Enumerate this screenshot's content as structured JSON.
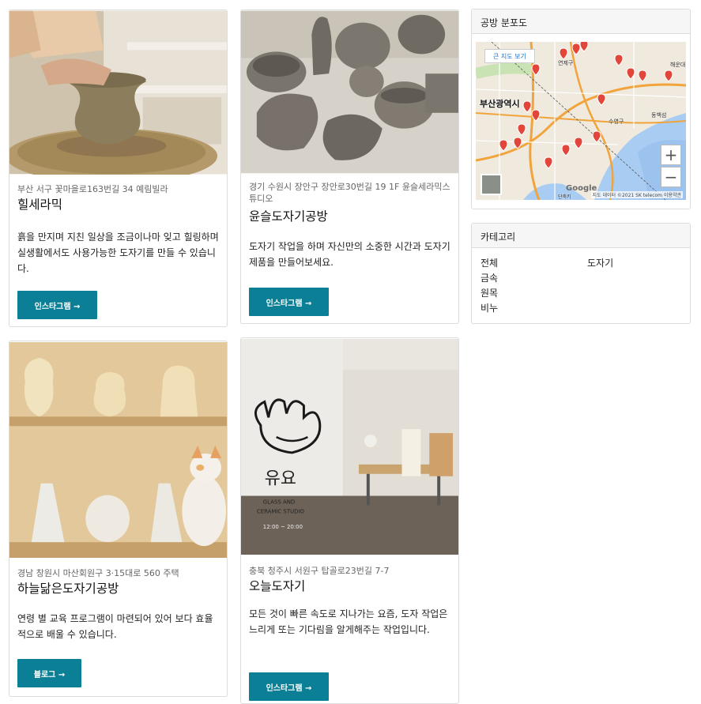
{
  "cards": [
    {
      "address": "부산 서구 꽃마을로163번길 34 예림빌라",
      "title": "힐세라믹",
      "description": "흙을 만지며 지친 일상을 조금이나마 잊고 힐링하며 실생활에서도 사용가능한 도자기를 만들 수 있습니다.",
      "button": "인스타그램 →"
    },
    {
      "address": "경기 수원시 장안구 장안로30번길 19 1F 윤슬세라믹스튜디오",
      "title": "윤슬도자기공방",
      "description": "도자기 작업을 하며 자신만의 소중한 시간과 도자기 제품을 만들어보세요.",
      "button": "인스타그램 →"
    },
    {
      "address": "경남 창원시 마산회원구 3·15대로 560 주택",
      "title": "하늘닮은도자기공방",
      "description": "연령 별 교육 프로그램이 마련되어 있어 보다 효율적으로 배울 수 있습니다.",
      "button": "블로그 →"
    },
    {
      "address": "충북 청주시 서원구 탑골로23번길 7-7",
      "title": "오늘도자기",
      "description": "모든 것이 빠른 속도로 지나가는 요즘, 도자 작업은 느리게 또는 기다림을 알게해주는 작업입니다.",
      "button": "인스타그램 →",
      "photo_sign": {
        "logo_text": "유요",
        "studio_line1": "GLASS AND",
        "studio_line2": "CERAMIC STUDIO",
        "hours": "12:00 ~ 20:00"
      }
    }
  ],
  "map_panel": {
    "title": "공방 분포도",
    "big_map_label": "큰 지도 보기",
    "zoom_in": "+",
    "zoom_out": "−",
    "city_label": "부산광역시",
    "district_labels": [
      "연제구",
      "수영구",
      "해운대",
      "동백섬",
      "단축키"
    ],
    "logo": "Google",
    "attribution": "지도 데이터 ©2021 SK telecom  이용약관",
    "colors": {
      "marker": "#e2453a",
      "road": "#f0a43b",
      "water": "#a8ccf2",
      "land": "#efe9de"
    }
  },
  "category_panel": {
    "title": "카테고리",
    "items": [
      "전체",
      "도자기",
      "금속",
      "원목",
      "비누"
    ]
  },
  "colors": {
    "button_bg": "#0a7f95",
    "button_text": "#ffffff"
  }
}
